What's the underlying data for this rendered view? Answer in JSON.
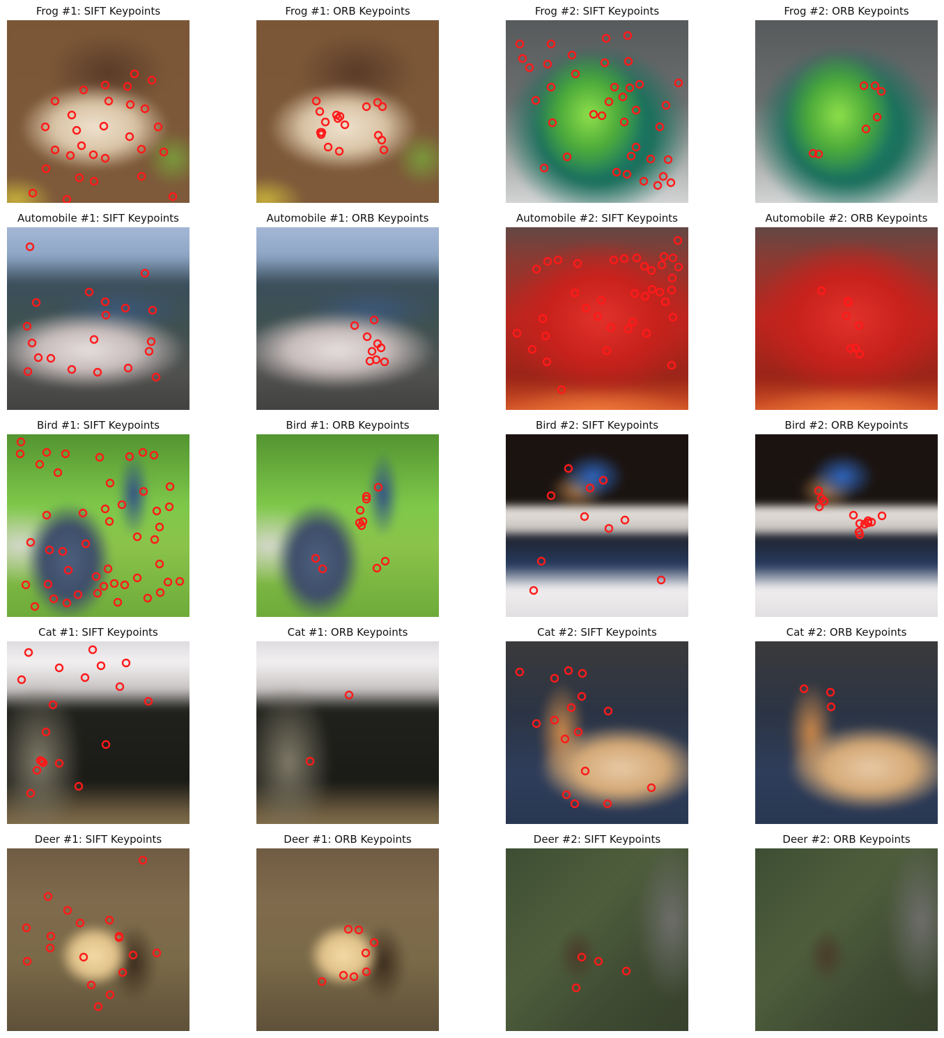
{
  "figure": {
    "keypoint_color": "#ff1a1a",
    "panels": [
      {
        "title": "Frog #1: SIFT Keypoints",
        "scene": "frog1"
      },
      {
        "title": "Frog #1: ORB Keypoints",
        "scene": "frog1"
      },
      {
        "title": "Frog #2: SIFT Keypoints",
        "scene": "frog2"
      },
      {
        "title": "Frog #2: ORB Keypoints",
        "scene": "frog2"
      },
      {
        "title": "Automobile #1: SIFT Keypoints",
        "scene": "car1"
      },
      {
        "title": "Automobile #1: ORB Keypoints",
        "scene": "car1"
      },
      {
        "title": "Automobile #2: SIFT Keypoints",
        "scene": "car2"
      },
      {
        "title": "Automobile #2: ORB Keypoints",
        "scene": "car2"
      },
      {
        "title": "Bird #1: SIFT Keypoints",
        "scene": "bird1"
      },
      {
        "title": "Bird #1: ORB Keypoints",
        "scene": "bird1"
      },
      {
        "title": "Bird #2: SIFT Keypoints",
        "scene": "bird2"
      },
      {
        "title": "Bird #2: ORB Keypoints",
        "scene": "bird2"
      },
      {
        "title": "Cat #1: SIFT Keypoints",
        "scene": "cat1"
      },
      {
        "title": "Cat #1: ORB Keypoints",
        "scene": "cat1"
      },
      {
        "title": "Cat #2: SIFT Keypoints",
        "scene": "cat2"
      },
      {
        "title": "Cat #2: ORB Keypoints",
        "scene": "cat2"
      },
      {
        "title": "Deer #1: SIFT Keypoints",
        "scene": "deer1"
      },
      {
        "title": "Deer #1: ORB Keypoints",
        "scene": "deer1"
      },
      {
        "title": "Deer #2: SIFT Keypoints",
        "scene": "deer2"
      },
      {
        "title": "Deer #2: ORB Keypoints",
        "scene": "deer2"
      }
    ]
  }
}
